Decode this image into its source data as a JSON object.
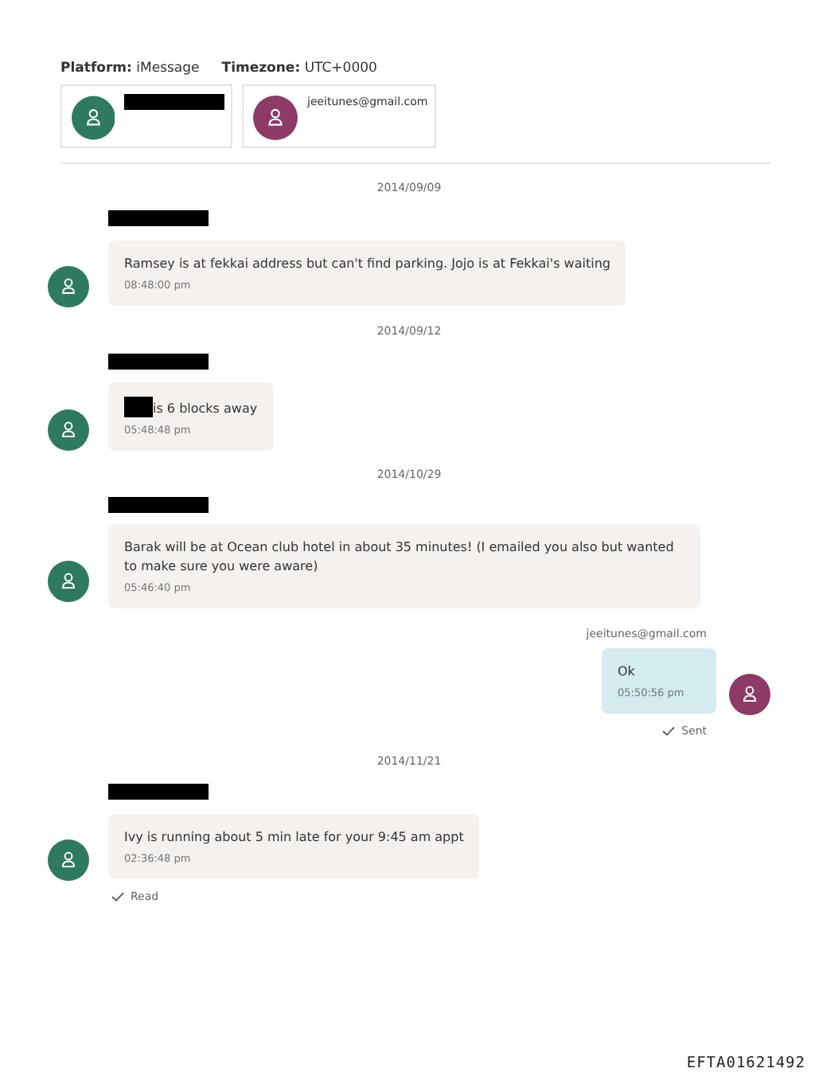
{
  "header": {
    "platform_label": "Platform:",
    "platform": "iMessage",
    "timezone_label": "Timezone:",
    "timezone": "UTC+0000"
  },
  "participants": [
    {
      "name_redacted": true,
      "color": "#2e7a5e"
    },
    {
      "name": "jeeitunes@gmail.com",
      "color": "#8e3a66"
    }
  ],
  "messages": [
    {
      "kind": "date",
      "text": "2014/09/09"
    },
    {
      "kind": "incoming",
      "sender_redacted": true,
      "color": "#2e7a5e",
      "text": "Ramsey is at fekkai address but can't find parking. Jojo is at Fekkai's waiting",
      "time": "08:48:00 pm"
    },
    {
      "kind": "date",
      "text": "2014/09/12"
    },
    {
      "kind": "incoming",
      "sender_redacted": true,
      "color": "#2e7a5e",
      "text_redacted_prefix": true,
      "text": "is 6 blocks away",
      "time": "05:48:48 pm"
    },
    {
      "kind": "date",
      "text": "2014/10/29"
    },
    {
      "kind": "incoming",
      "sender_redacted": true,
      "color": "#2e7a5e",
      "text": "Barak will be at Ocean club hotel in about 35 minutes! (I emailed you also but wanted to make sure you were aware)",
      "time": "05:46:40 pm"
    },
    {
      "kind": "outgoing",
      "sender": "jeeitunes@gmail.com",
      "color": "#8e3a66",
      "text": "Ok",
      "time": "05:50:56 pm",
      "status": "Sent"
    },
    {
      "kind": "date",
      "text": "2014/11/21"
    },
    {
      "kind": "incoming",
      "sender_redacted": true,
      "color": "#2e7a5e",
      "text": "Ivy is running about 5 min late for your 9:45 am appt",
      "time": "02:36:48 pm",
      "status": "Read"
    }
  ],
  "stamp": "EFTA01621492"
}
